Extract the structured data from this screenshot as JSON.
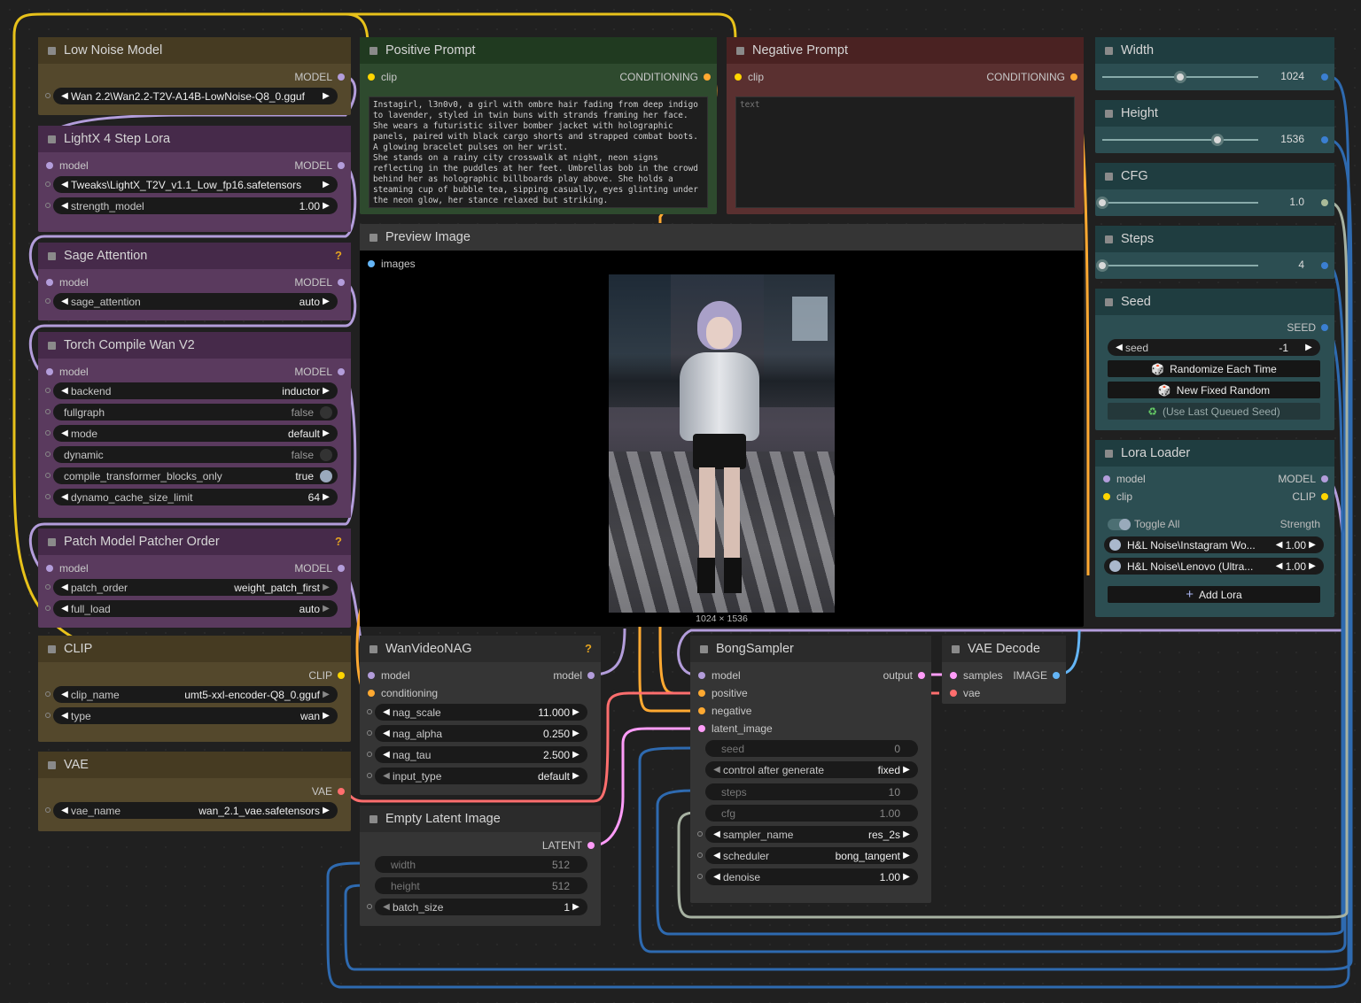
{
  "nodes": {
    "low_noise": {
      "title": "Low Noise Model",
      "out": "MODEL",
      "widget": "Wan 2.2\\Wan2.2-T2V-A14B-LowNoise-Q8_0.gguf"
    },
    "lightx": {
      "title": "LightX 4 Step Lora",
      "in": "model",
      "out": "MODEL",
      "w1": "Tweaks\\LightX_T2V_v1.1_Low_fp16.safetensors",
      "w2_label": "strength_model",
      "w2_value": "1.00"
    },
    "sage": {
      "title": "Sage Attention",
      "in": "model",
      "out": "MODEL",
      "w_label": "sage_attention",
      "w_value": "auto",
      "badge": "?"
    },
    "torch": {
      "title": "Torch Compile Wan V2",
      "in": "model",
      "out": "MODEL",
      "widgets": [
        {
          "label": "backend",
          "value": "inductor"
        },
        {
          "label": "fullgraph",
          "value": "false"
        },
        {
          "label": "mode",
          "value": "default"
        },
        {
          "label": "dynamic",
          "value": "false"
        },
        {
          "label": "compile_transformer_blocks_only",
          "value": "true"
        },
        {
          "label": "dynamo_cache_size_limit",
          "value": "64"
        }
      ]
    },
    "patch": {
      "title": "Patch Model Patcher Order",
      "in": "model",
      "out": "MODEL",
      "badge": "?",
      "widgets": [
        {
          "label": "patch_order",
          "value": "weight_patch_first"
        },
        {
          "label": "full_load",
          "value": "auto"
        }
      ]
    },
    "clip": {
      "title": "CLIP",
      "out": "CLIP",
      "widgets": [
        {
          "label": "clip_name",
          "value": "umt5-xxl-encoder-Q8_0.gguf"
        },
        {
          "label": "type",
          "value": "wan"
        }
      ]
    },
    "vae": {
      "title": "VAE",
      "out": "VAE",
      "widgets": [
        {
          "label": "vae_name",
          "value": "wan_2.1_vae.safetensors"
        }
      ]
    },
    "positive": {
      "title": "Positive Prompt",
      "in": "clip",
      "out": "CONDITIONING",
      "text": "Instagirl, l3n0v0, a girl with ombre hair fading from deep indigo to lavender, styled in twin buns with strands framing her face. She wears a futuristic silver bomber jacket with holographic panels, paired with black cargo shorts and strapped combat boots. A glowing bracelet pulses on her wrist.\nShe stands on a rainy city crosswalk at night, neon signs reflecting in the puddles at her feet. Umbrellas bob in the crowd behind her as holographic billboards play above. She holds a steaming cup of bubble tea, sipping casually, eyes glinting under the neon glow, her stance relaxed but striking."
    },
    "negative": {
      "title": "Negative Prompt",
      "in": "clip",
      "out": "CONDITIONING",
      "placeholder": "text"
    },
    "preview": {
      "title": "Preview Image",
      "in": "images",
      "caption": "1024 × 1536"
    },
    "width": {
      "title": "Width",
      "value": "1024",
      "level": 0.5
    },
    "height": {
      "title": "Height",
      "value": "1536",
      "level": 0.74
    },
    "cfg": {
      "title": "CFG",
      "value": "1.0",
      "level": 0.0
    },
    "steps": {
      "title": "Steps",
      "value": "4",
      "level": 0.0
    },
    "seed": {
      "title": "Seed",
      "out": "SEED",
      "w_label": "seed",
      "w_value": "-1",
      "buttons": [
        "Randomize Each Time",
        "New Fixed Random",
        "(Use Last Queued Seed)"
      ]
    },
    "lora": {
      "title": "Lora Loader",
      "in1": "model",
      "in2": "clip",
      "out1": "MODEL",
      "out2": "CLIP",
      "toggle_all": "Toggle All",
      "strength": "Strength",
      "loras": [
        {
          "name": "H&L Noise\\Instagram Wo...",
          "value": "1.00"
        },
        {
          "name": "H&L Noise\\Lenovo (Ultra...",
          "value": "1.00"
        }
      ],
      "add": "Add Lora"
    },
    "nag": {
      "title": "WanVideoNAG",
      "badge": "?",
      "in1": "model",
      "in2": "conditioning",
      "out": "model",
      "widgets": [
        {
          "label": "nag_scale",
          "value": "11.000"
        },
        {
          "label": "nag_alpha",
          "value": "0.250"
        },
        {
          "label": "nag_tau",
          "value": "2.500"
        },
        {
          "label": "input_type",
          "value": "default"
        }
      ]
    },
    "latent": {
      "title": "Empty Latent Image",
      "out": "LATENT",
      "widgets": [
        {
          "label": "width",
          "value": "512"
        },
        {
          "label": "height",
          "value": "512"
        },
        {
          "label": "batch_size",
          "value": "1"
        }
      ]
    },
    "bong": {
      "title": "BongSampler",
      "out": "output",
      "inputs": [
        "model",
        "positive",
        "negative",
        "latent_image"
      ],
      "widgets": [
        {
          "label": "seed",
          "value": "0"
        },
        {
          "label": "control after generate",
          "value": "fixed"
        },
        {
          "label": "steps",
          "value": "10"
        },
        {
          "label": "cfg",
          "value": "1.00"
        },
        {
          "label": "sampler_name",
          "value": "res_2s"
        },
        {
          "label": "scheduler",
          "value": "bong_tangent"
        },
        {
          "label": "denoise",
          "value": "1.00"
        }
      ]
    },
    "vaedecode": {
      "title": "VAE Decode",
      "in1": "samples",
      "in2": "vae",
      "out": "IMAGE"
    }
  },
  "colors": {
    "model": "#b39ddb",
    "clip": "#ffd500",
    "conditioning": "#ffa931",
    "vae": "#ff6e6e",
    "latent": "#ff9cf9",
    "image": "#64b5f6",
    "int": "#3b7fd1",
    "float": "#aabb99"
  }
}
